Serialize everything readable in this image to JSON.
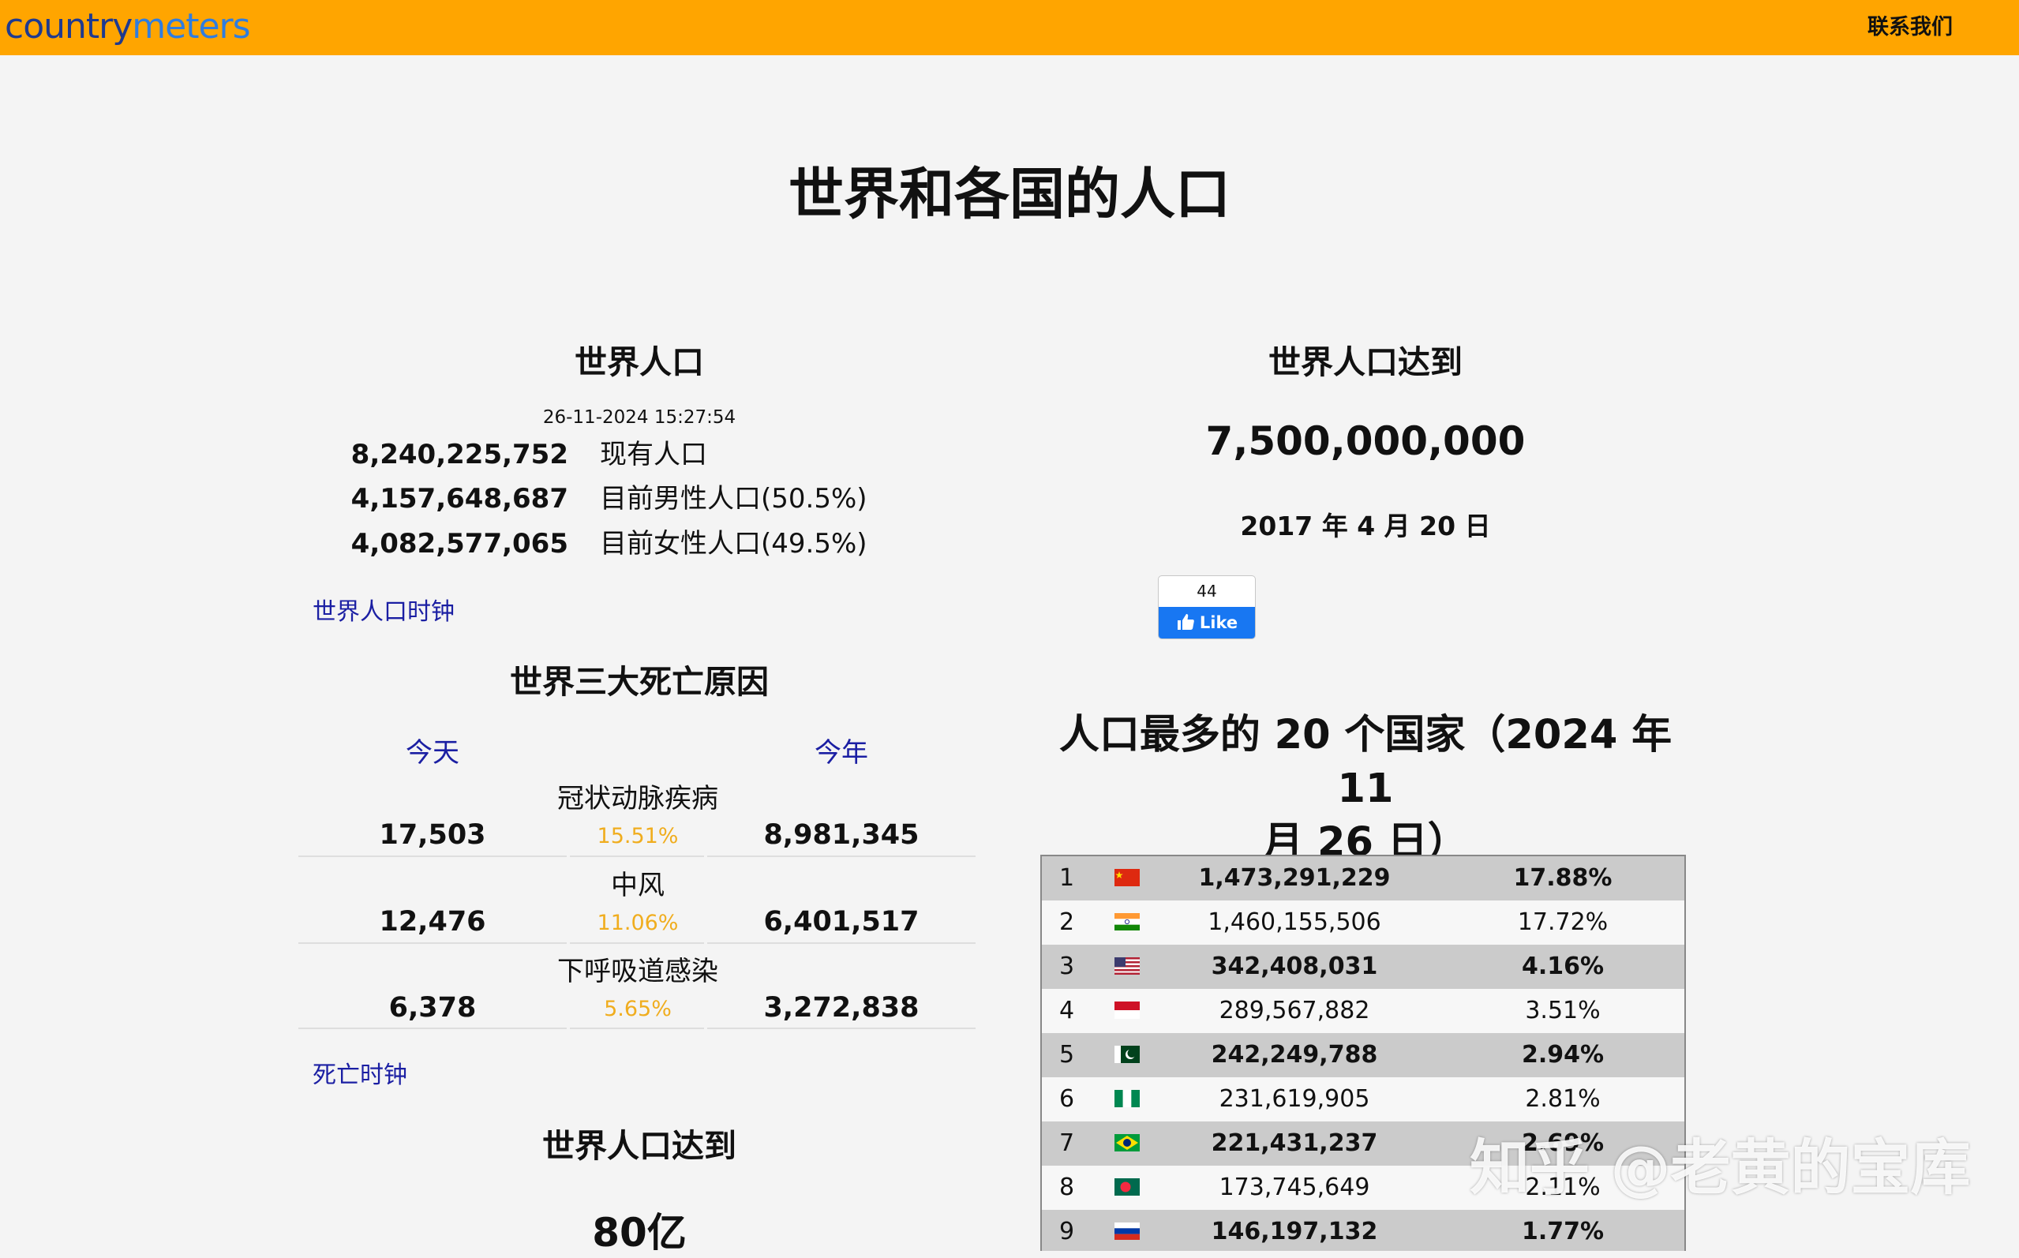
{
  "header": {
    "logo_part1": "country",
    "logo_part2": "meters",
    "contact_link": "联系我们",
    "brand_colors": {
      "bar": "#ffa500",
      "logo_dark": "#1f3a8f",
      "logo_light": "#2f7de0"
    }
  },
  "page_title": "世界和各国的人口",
  "world_population": {
    "title": "世界人口",
    "timestamp": "26-11-2024 15:27:54",
    "rows": [
      {
        "value": "8,240,225,752",
        "label": "现有人口"
      },
      {
        "value": "4,157,648,687",
        "label": "目前男性人口(50.5%)"
      },
      {
        "value": "4,082,577,065",
        "label": "目前女性人口(49.5%)"
      }
    ],
    "clock_link": "世界人口时钟"
  },
  "death_causes": {
    "title": "世界三大死亡原因",
    "col_today": "今天",
    "col_year": "今年",
    "items": [
      {
        "name": "冠状动脉疾病",
        "today": "17,503",
        "percent": "15.51%",
        "year": "8,981,345"
      },
      {
        "name": "中风",
        "today": "12,476",
        "percent": "11.06%",
        "year": "6,401,517"
      },
      {
        "name": "下呼吸道感染",
        "today": "6,378",
        "percent": "5.65%",
        "year": "3,272,838"
      }
    ],
    "clock_link": "死亡时钟"
  },
  "reached_left": {
    "title": "世界人口达到",
    "value": "80亿"
  },
  "reached_right": {
    "title": "世界人口达到",
    "value": "7,500,000,000",
    "date": "2017 年 4 月 20 日"
  },
  "fb_like": {
    "count": "44",
    "label": "Like"
  },
  "top20": {
    "title_line1": "人口最多的 20 个国家（2024 年 11",
    "title_line2": "月 26 日）",
    "rows": [
      {
        "rank": "1",
        "flag": "china-flag-icon",
        "population": "1,473,291,229",
        "percent": "17.88%"
      },
      {
        "rank": "2",
        "flag": "india-flag-icon",
        "population": "1,460,155,506",
        "percent": "17.72%"
      },
      {
        "rank": "3",
        "flag": "usa-flag-icon",
        "population": "342,408,031",
        "percent": "4.16%"
      },
      {
        "rank": "4",
        "flag": "indonesia-flag-icon",
        "population": "289,567,882",
        "percent": "3.51%"
      },
      {
        "rank": "5",
        "flag": "pakistan-flag-icon",
        "population": "242,249,788",
        "percent": "2.94%"
      },
      {
        "rank": "6",
        "flag": "nigeria-flag-icon",
        "population": "231,619,905",
        "percent": "2.81%"
      },
      {
        "rank": "7",
        "flag": "brazil-flag-icon",
        "population": "221,431,237",
        "percent": "2.69%"
      },
      {
        "rank": "8",
        "flag": "bangladesh-flag-icon",
        "population": "173,745,649",
        "percent": "2.11%"
      },
      {
        "rank": "9",
        "flag": "russia-flag-icon",
        "population": "146,197,132",
        "percent": "1.77%"
      }
    ]
  },
  "watermark": "知乎 @老黄的宝库"
}
